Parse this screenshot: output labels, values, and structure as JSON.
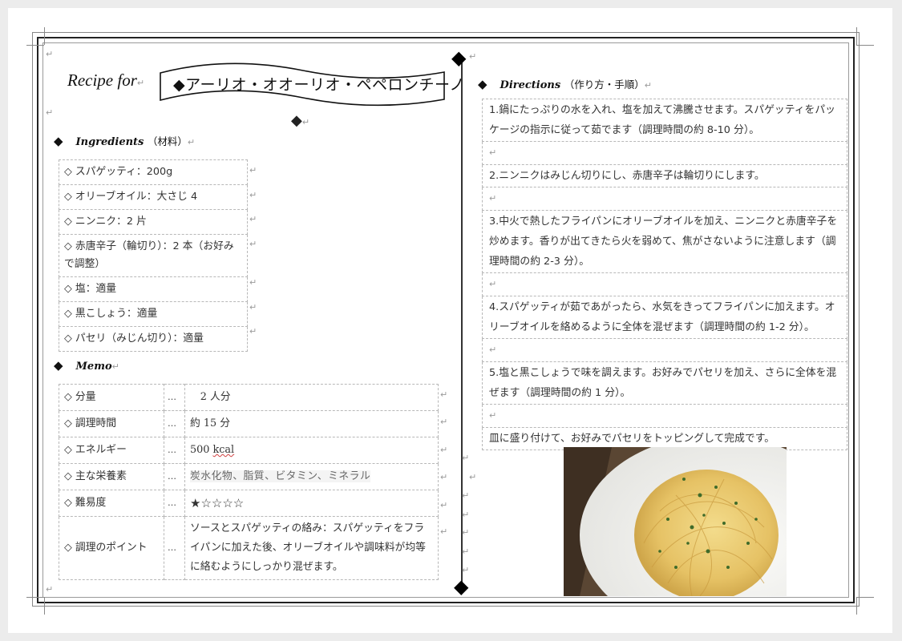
{
  "document": {
    "recipe_for_label": "Recipe for",
    "title": "◆アーリオ・オオーリオ・ペペロンチーノ",
    "paragraph_mark": "↵",
    "diamond": "◆"
  },
  "ingredients": {
    "heading": "Ingredients",
    "heading_jp": "（材料）",
    "items": [
      "◇ スパゲッティ：200g",
      "◇ オリーブオイル：大さじ 4",
      "◇ ニンニク：2 片",
      "◇ 赤唐辛子（輪切り）：2 本（お好みで調整）",
      "◇ 塩：適量",
      "◇ 黒こしょう：適量",
      "◇ パセリ（みじん切り）：適量"
    ]
  },
  "memo": {
    "heading": "Memo",
    "dots": "…",
    "rows": [
      {
        "label": "◇ 分量",
        "value": "　2 人分"
      },
      {
        "label": "◇ 調理時間",
        "value": "約 15 分"
      },
      {
        "label": "◇ エネルギー",
        "value_number": " 500 ",
        "value_unit": "kcal"
      },
      {
        "label": "◇ 主な栄養素",
        "value": "炭水化物、脂質、ビタミン、ミネラル"
      },
      {
        "label": "◇ 難易度",
        "value": "★☆☆☆☆",
        "difficulty_rating": 1,
        "difficulty_max": 5
      },
      {
        "label": "◇ 調理のポイント",
        "value": "ソースとスパゲッティの絡み：スパゲッティをフライパンに加えた後、オリーブオイルや調味料が均等に絡むようにしっかり混ぜます。"
      }
    ]
  },
  "directions": {
    "heading": "Directions",
    "heading_jp": "（作り方・手順）",
    "steps": [
      "1.鍋にたっぷりの水を入れ、塩を加えて沸騰させます。スパゲッティをパッケージの指示に従って茹でます（調理時間の約 8-10 分）。",
      "",
      "2.ニンニクはみじん切りにし、赤唐辛子は輪切りにします。",
      "",
      "3.中火で熱したフライパンにオリーブオイルを加え、ニンニクと赤唐辛子を炒めます。香りが出てきたら火を弱めて、焦がさないように注意します（調理時間の約 2-3 分）。",
      "",
      "4.スパゲッティが茹であがったら、水気をきってフライパンに加えます。オリーブオイルを絡めるように全体を混ぜます（調理時間の約 1-2 分）。",
      "",
      "5.塩と黒こしょうで味を調えます。お好みでパセリを加え、さらに全体を混ぜます（調理時間の約 1 分）。",
      "",
      "皿に盛り付けて、お好みでパセリをトッピングして完成です。"
    ]
  },
  "photo": {
    "alt": "ペペロンチーノの写真",
    "colors": {
      "plate": "#f4f4f2",
      "pasta": "#e8c66a",
      "table": "#5a4633",
      "parsley": "#3f6b2a"
    }
  }
}
